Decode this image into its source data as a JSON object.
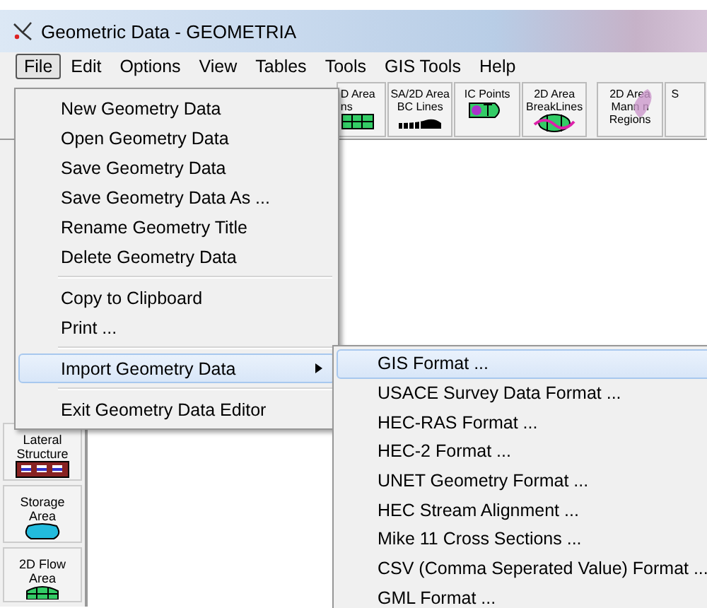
{
  "window": {
    "title": "Geometric Data - GEOMETRIA"
  },
  "menu_bar": [
    {
      "label": "File",
      "selected": true
    },
    {
      "label": "Edit",
      "selected": false
    },
    {
      "label": "Options",
      "selected": false
    },
    {
      "label": "View",
      "selected": false
    },
    {
      "label": "Tables",
      "selected": false
    },
    {
      "label": "Tools",
      "selected": false
    },
    {
      "label": "GIS Tools",
      "selected": false
    },
    {
      "label": "Help",
      "selected": false
    }
  ],
  "toolbar": [
    {
      "kind": "grid",
      "lines": [
        "D Area",
        "ns"
      ]
    },
    {
      "kind": "bc-lines",
      "lines": [
        "SA/2D Area",
        "BC Lines"
      ]
    },
    {
      "kind": "points",
      "lines": [
        "IC Points"
      ]
    },
    {
      "kind": "breaklines",
      "lines": [
        "2D Area",
        "BreakLines"
      ]
    },
    {
      "kind": "mann",
      "lines": [
        "2D Area",
        "Mann n",
        "Regions"
      ]
    },
    {
      "kind": "blank",
      "lines": [
        "S"
      ]
    }
  ],
  "side_toolbar": [
    {
      "kind": "lateral",
      "lines": [
        "Lateral",
        "Structure"
      ]
    },
    {
      "kind": "storage",
      "lines": [
        "Storage",
        "Area"
      ]
    },
    {
      "kind": "flow",
      "lines": [
        "2D Flow",
        "Area"
      ]
    }
  ],
  "file_menu": [
    {
      "kind": "item",
      "label": "New Geometry Data",
      "selected": false
    },
    {
      "kind": "item",
      "label": "Open Geometry Data",
      "selected": false
    },
    {
      "kind": "item",
      "label": "Save Geometry Data",
      "selected": false
    },
    {
      "kind": "item",
      "label": "Save Geometry Data As ...",
      "selected": false
    },
    {
      "kind": "item",
      "label": "Rename Geometry Title",
      "selected": false
    },
    {
      "kind": "item",
      "label": "Delete Geometry Data",
      "selected": false
    },
    {
      "kind": "separator"
    },
    {
      "kind": "item",
      "label": "Copy to Clipboard",
      "selected": false
    },
    {
      "kind": "item",
      "label": "Print ...",
      "selected": false
    },
    {
      "kind": "separator"
    },
    {
      "kind": "submenu",
      "label": "Import Geometry Data",
      "selected": true
    },
    {
      "kind": "separator"
    },
    {
      "kind": "item",
      "label": "Exit Geometry Data Editor",
      "selected": false
    }
  ],
  "import_submenu": [
    {
      "label": "GIS Format ...",
      "selected": true
    },
    {
      "label": "USACE Survey Data Format ...",
      "selected": false
    },
    {
      "label": "HEC-RAS Format ...",
      "selected": false
    },
    {
      "label": "HEC-2 Format ...",
      "selected": false
    },
    {
      "label": "UNET Geometry Format ...",
      "selected": false
    },
    {
      "label": "HEC Stream Alignment ...",
      "selected": false
    },
    {
      "label": "Mike 11 Cross Sections ...",
      "selected": false
    },
    {
      "label": "CSV (Comma Seperated Value) Format ...",
      "selected": false
    },
    {
      "label": "GML Format ...",
      "selected": false
    }
  ]
}
